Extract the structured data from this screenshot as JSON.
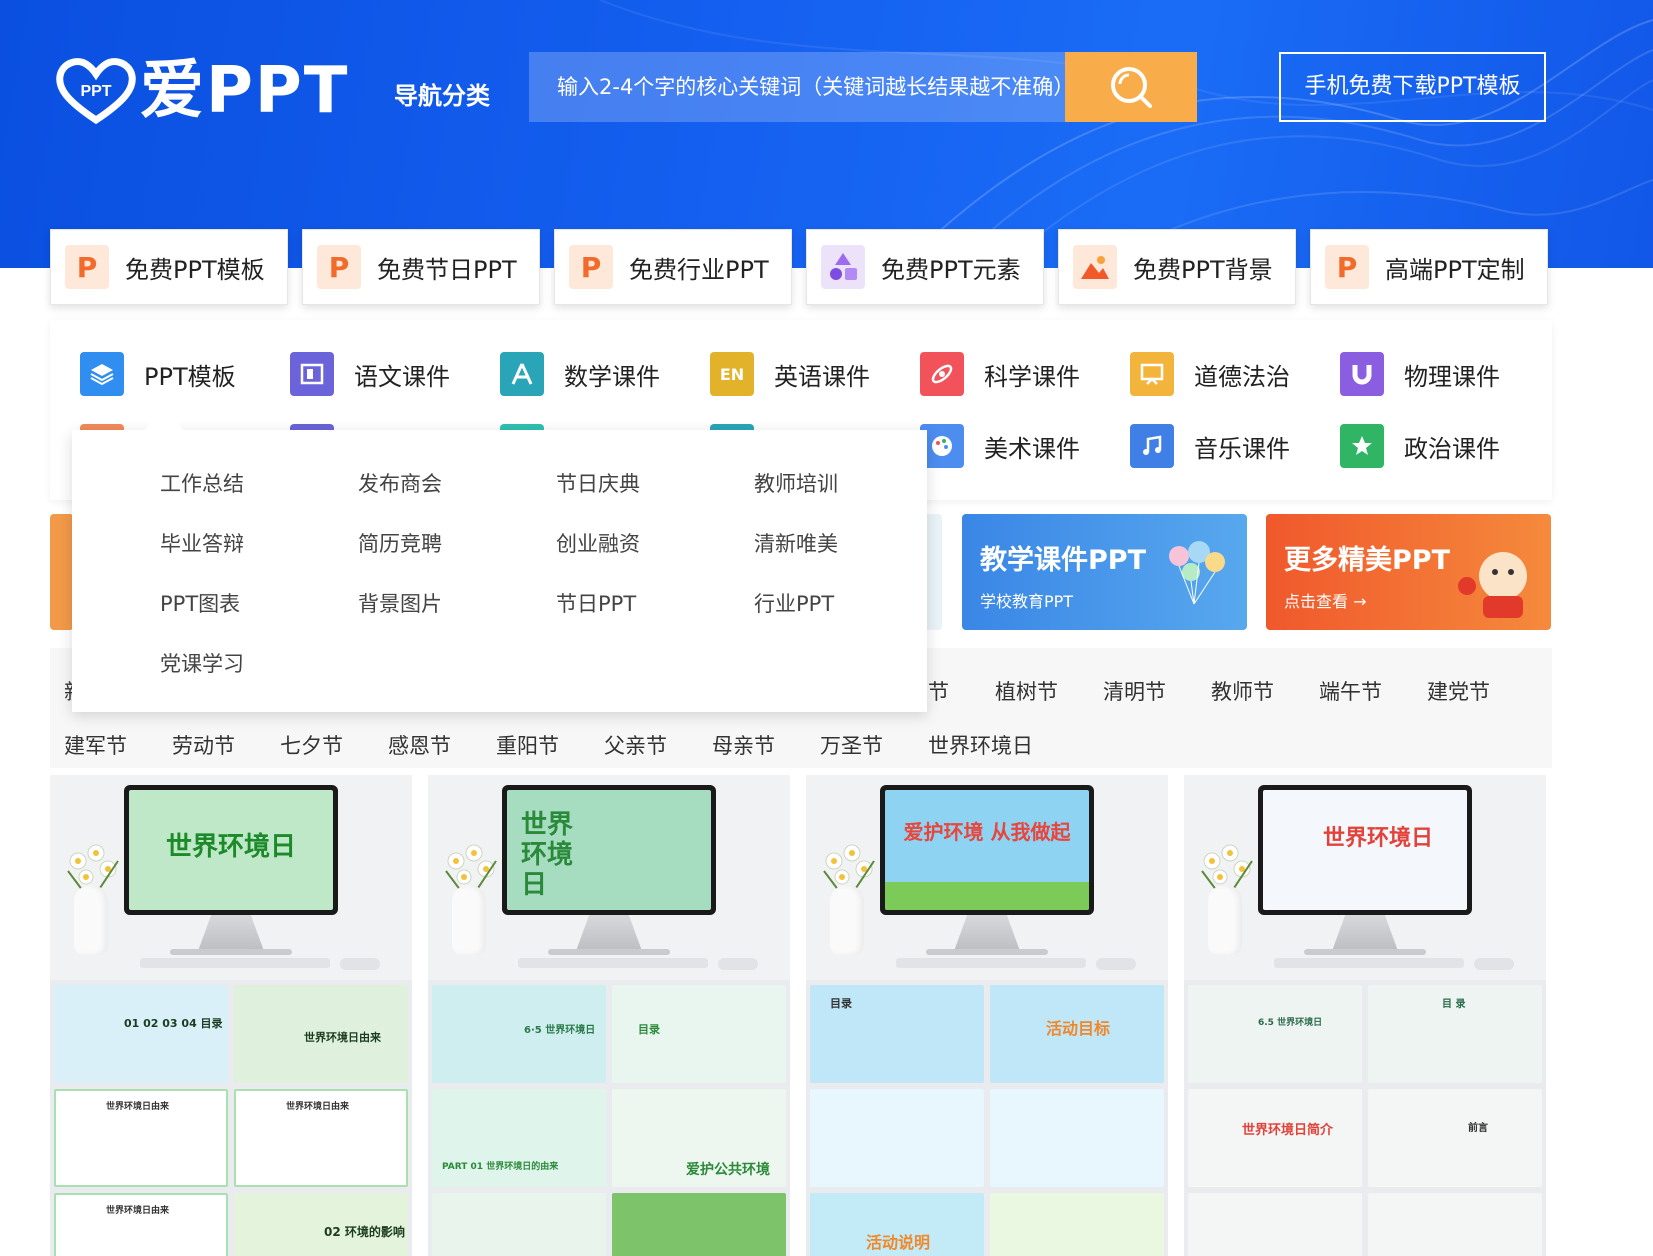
{
  "header": {
    "logo_text": "爱PPT",
    "logo_badge": "PPT",
    "nav_label": "导航分类",
    "search_placeholder": "输入2-4个字的核心关键词（关键词越长结果越不准确）",
    "download_label": "手机免费下载PPT模板"
  },
  "categories": [
    {
      "label": "免费PPT模板",
      "icon": "ppt-p-icon",
      "color": "#fde8d9"
    },
    {
      "label": "免费节日PPT",
      "icon": "ppt-p-icon",
      "color": "#fde8d9"
    },
    {
      "label": "免费行业PPT",
      "icon": "ppt-p-icon",
      "color": "#fde8d9"
    },
    {
      "label": "免费PPT元素",
      "icon": "shapes-icon",
      "color": "#ece3fb"
    },
    {
      "label": "免费PPT背景",
      "icon": "image-icon",
      "color": "#fde8d9"
    },
    {
      "label": "高端PPT定制",
      "icon": "ppt-p-icon",
      "color": "#fde8d9"
    }
  ],
  "subjects": [
    {
      "label": "PPT模板",
      "icon": "layers-icon",
      "color": "#2f8ef0"
    },
    {
      "label": "语文课件",
      "icon": "book-icon",
      "color": "#6a63d9"
    },
    {
      "label": "数学课件",
      "icon": "compass-icon",
      "color": "#2aa5b8"
    },
    {
      "label": "英语课件",
      "icon": "en-icon",
      "color": "#e2b32a"
    },
    {
      "label": "科学课件",
      "icon": "atom-icon",
      "color": "#f2525a"
    },
    {
      "label": "道德法治",
      "icon": "board-icon",
      "color": "#f3b43c"
    },
    {
      "label": "物理课件",
      "icon": "magnet-icon",
      "color": "#8b5de0"
    },
    {
      "label": "美术课件",
      "icon": "palette-icon",
      "color": "#4d8df0"
    },
    {
      "label": "音乐课件",
      "icon": "music-icon",
      "color": "#3f7fe6"
    },
    {
      "label": "政治课件",
      "icon": "star-icon",
      "color": "#2fb564"
    }
  ],
  "dropdown": {
    "items": [
      "工作总结",
      "发布商会",
      "节日庆典",
      "教师培训",
      "毕业答辩",
      "简历竞聘",
      "创业融资",
      "清新唯美",
      "PPT图表",
      "背景图片",
      "节日PPT",
      "行业PPT",
      "党课学习"
    ]
  },
  "banners": [
    {
      "title": "教学课件PPT",
      "subtitle": "学校教育PPT",
      "color": "#3e8eea"
    },
    {
      "title": "更多精美PPT",
      "subtitle": "点击查看 →",
      "color": "#f1612d"
    }
  ],
  "tags": {
    "row1_partial_left": "新",
    "row1_partial_cut": "节",
    "row1": [
      "植树节",
      "清明节",
      "教师节",
      "端午节",
      "建党节"
    ],
    "row2": [
      "建军节",
      "劳动节",
      "七夕节",
      "感恩节",
      "重阳节",
      "父亲节",
      "母亲节",
      "万圣节",
      "世界环境日"
    ]
  },
  "templates": [
    {
      "title": "世界环境日",
      "title_color": "#1d8a2a",
      "screen": "#bfe8c8",
      "slides": [
        "01 02 03 04 目录",
        "世界环境日由来",
        "世界环境日由来",
        "世界环境日由来",
        "世界环境日由来",
        "02 环境的影响"
      ]
    },
    {
      "title": "世界环境日",
      "title_color": "#2b8a3a",
      "screen": "#a6dcc0",
      "slides": [
        "6·5 世界环境日",
        "目录",
        "PART 01 世界环境日的由来",
        "爱护公共环境",
        "",
        ""
      ]
    },
    {
      "title": "爱护环境 从我做起",
      "title_color": "#e8453c",
      "screen": "#8fd3f3",
      "slides": [
        "目录",
        "活动目标",
        "",
        "",
        "活动说明",
        ""
      ]
    },
    {
      "title": "世界环境日",
      "title_color": "#e2423a",
      "screen": "#f4f7fb",
      "slides": [
        "6.5 世界环境日",
        "目 录",
        "世界环境日简介",
        "前言",
        "",
        ""
      ]
    }
  ]
}
